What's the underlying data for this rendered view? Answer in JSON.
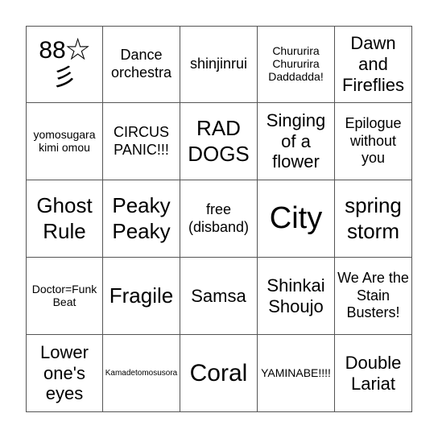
{
  "bingo": {
    "cells": [
      {
        "text": "88☆彡",
        "size": "s-xxl"
      },
      {
        "text": "Dance orchestra",
        "size": "s-m"
      },
      {
        "text": "shinjinrui",
        "size": "s-m"
      },
      {
        "text": "Chururira Chururira Daddadda!",
        "size": "s-s"
      },
      {
        "text": "Dawn and Fireflies",
        "size": "s-l"
      },
      {
        "text": "yomosugara kimi omou",
        "size": "s-s"
      },
      {
        "text": "CIRCUS PANIC!!!",
        "size": "s-m"
      },
      {
        "text": "RAD DOGS",
        "size": "s-xl"
      },
      {
        "text": "Singing of a flower",
        "size": "s-l"
      },
      {
        "text": "Epilogue without you",
        "size": "s-m"
      },
      {
        "text": "Ghost Rule",
        "size": "s-xl"
      },
      {
        "text": "Peaky Peaky",
        "size": "s-xl"
      },
      {
        "text": "free (disband)",
        "size": "s-m"
      },
      {
        "text": "City",
        "size": "s-xxxl"
      },
      {
        "text": "spring storm",
        "size": "s-xl"
      },
      {
        "text": "Doctor=Funk Beat",
        "size": "s-s"
      },
      {
        "text": "Fragile",
        "size": "s-xl"
      },
      {
        "text": "Samsa",
        "size": "s-l"
      },
      {
        "text": "Shinkai Shoujo",
        "size": "s-l"
      },
      {
        "text": "We Are the Stain Busters!",
        "size": "s-m"
      },
      {
        "text": "Lower one's eyes",
        "size": "s-l"
      },
      {
        "text": "Kamadetomosusora",
        "size": "s-xs"
      },
      {
        "text": "Coral",
        "size": "s-xxl"
      },
      {
        "text": "YAMINABE!!!!",
        "size": "s-s"
      },
      {
        "text": "Double Lariat",
        "size": "s-l"
      }
    ]
  }
}
